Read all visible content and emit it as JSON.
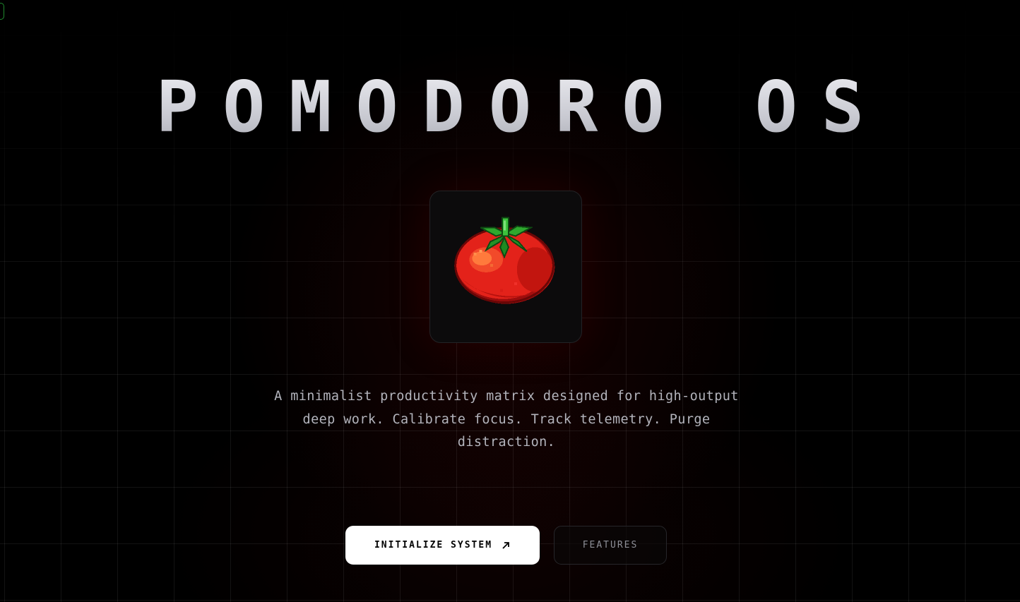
{
  "hero": {
    "title": "POMODORO OS",
    "tagline": "A minimalist productivity matrix designed for high-output deep work. Calibrate focus. Track telemetry. Purge distraction."
  },
  "logo": {
    "icon": "pixel-tomato-icon"
  },
  "actions": {
    "primary_label": "INITIALIZE SYSTEM",
    "primary_icon": "arrow-up-right-icon",
    "secondary_label": "FEATURES"
  },
  "colors": {
    "background": "#000000",
    "primary_button": "#ffffff",
    "tomato_red": "#e8281c",
    "stem_green": "#2ea82e"
  }
}
